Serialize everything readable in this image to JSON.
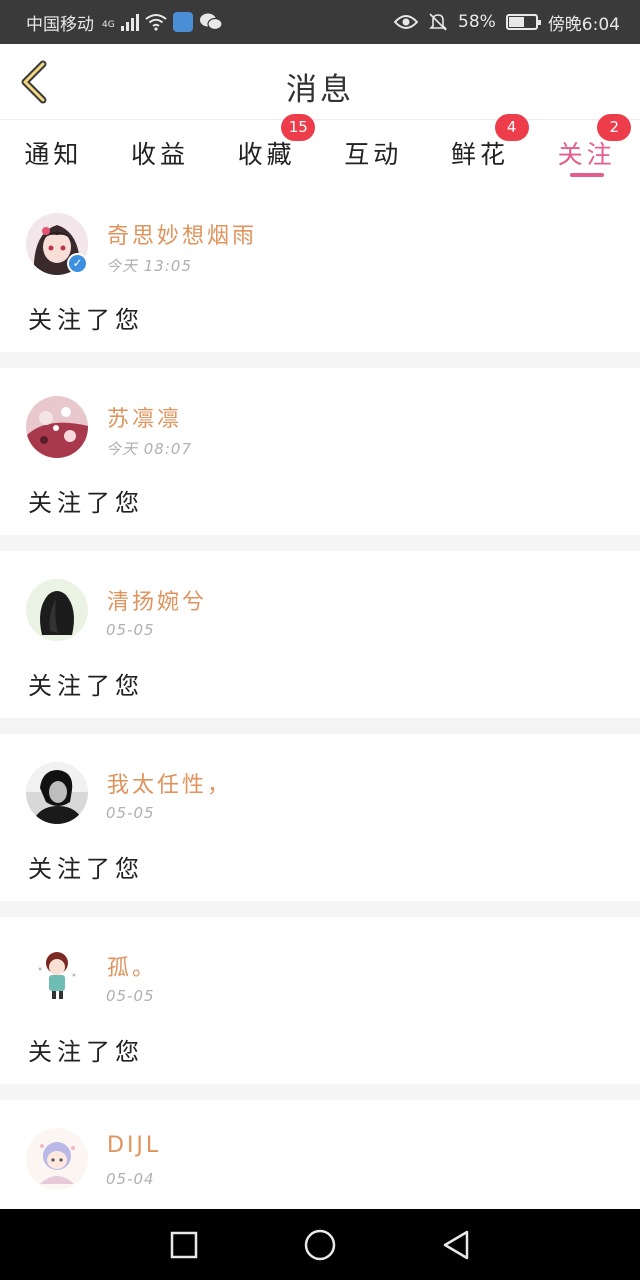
{
  "status_bar": {
    "carrier": "中国移动",
    "network": "4G",
    "battery": "58%",
    "battery_level": 0.58,
    "time": "傍晚6:04"
  },
  "header": {
    "title": "消息"
  },
  "tabs": [
    {
      "label": "通知",
      "badge": "",
      "active": false
    },
    {
      "label": "收益",
      "badge": "",
      "active": false
    },
    {
      "label": "收藏",
      "badge": "15",
      "active": false
    },
    {
      "label": "互动",
      "badge": "",
      "active": false
    },
    {
      "label": "鲜花",
      "badge": "4",
      "active": false
    },
    {
      "label": "关注",
      "badge": "2",
      "active": true
    }
  ],
  "messages": [
    {
      "name": "奇思妙想烟雨",
      "time": "今天 13:05",
      "action": "关注了您",
      "verified": true
    },
    {
      "name": "苏凛凛",
      "time": "今天 08:07",
      "action": "关注了您",
      "verified": false
    },
    {
      "name": "清扬婉兮",
      "time": "05-05",
      "action": "关注了您",
      "verified": false
    },
    {
      "name": "我太任性，",
      "time": "05-05",
      "action": "关注了您",
      "verified": false
    },
    {
      "name": "孤。",
      "time": "05-05",
      "action": "关注了您",
      "verified": false
    },
    {
      "name": "DIJL",
      "time": "05-04",
      "action": "",
      "verified": false
    }
  ],
  "colors": {
    "accent": "#e45d8c",
    "username": "#e0935c",
    "badge": "#ee3d4a",
    "verified": "#3d8fe0"
  },
  "icons": {
    "back": "chevron-left-icon",
    "verified": "verified-check-icon",
    "nav_recent": "square-icon",
    "nav_home": "circle-icon",
    "nav_back": "triangle-back-icon"
  }
}
